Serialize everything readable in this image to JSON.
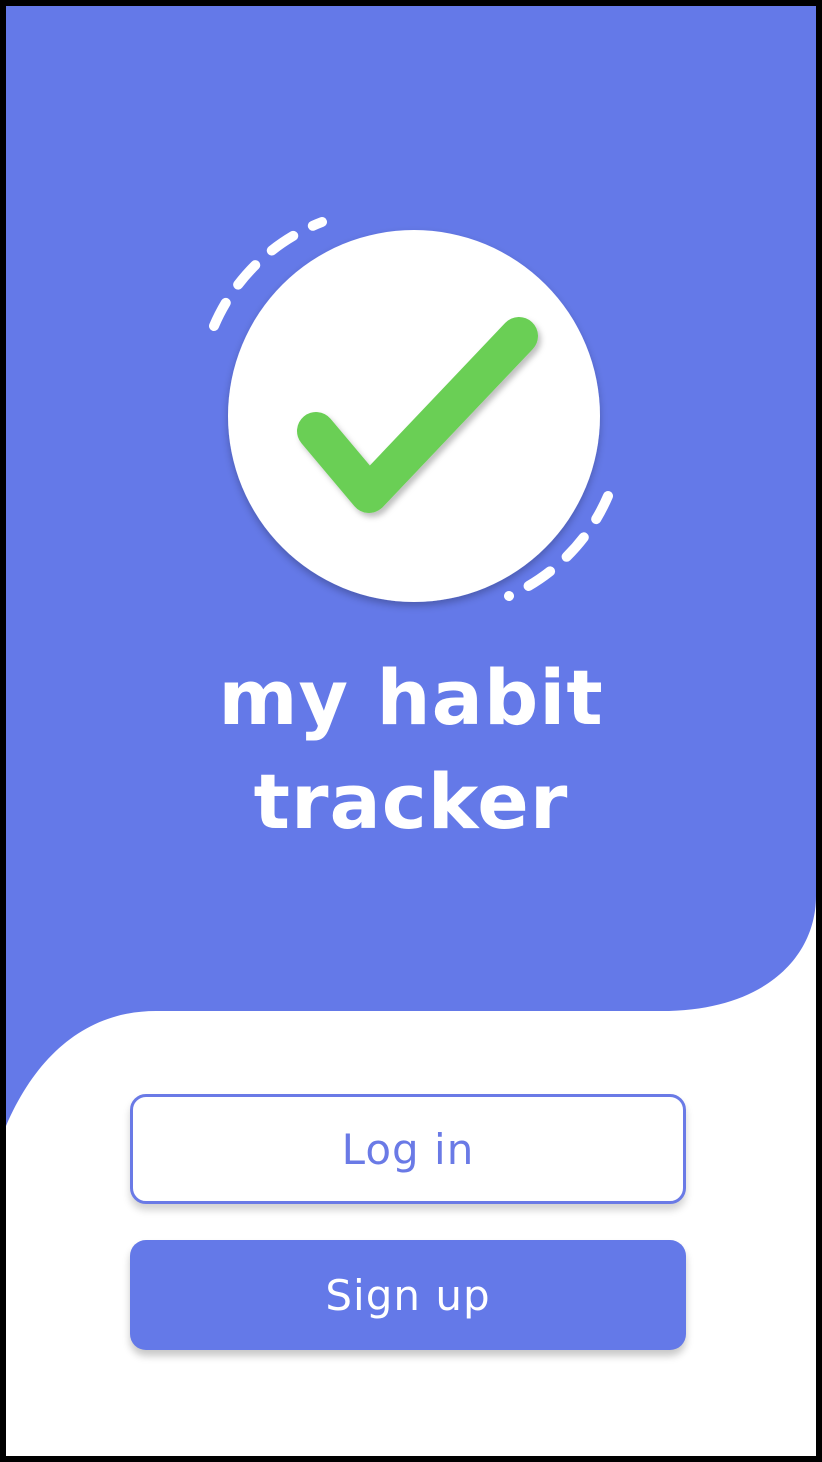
{
  "app": {
    "title_line1": "my habit",
    "title_line2": "tracker"
  },
  "actions": {
    "login_label": "Log in",
    "signup_label": "Sign up"
  },
  "icons": {
    "logo": "check-circle-icon"
  },
  "colors": {
    "primary": "#6479e8",
    "check_green": "#6acf55",
    "background": "#ffffff"
  }
}
